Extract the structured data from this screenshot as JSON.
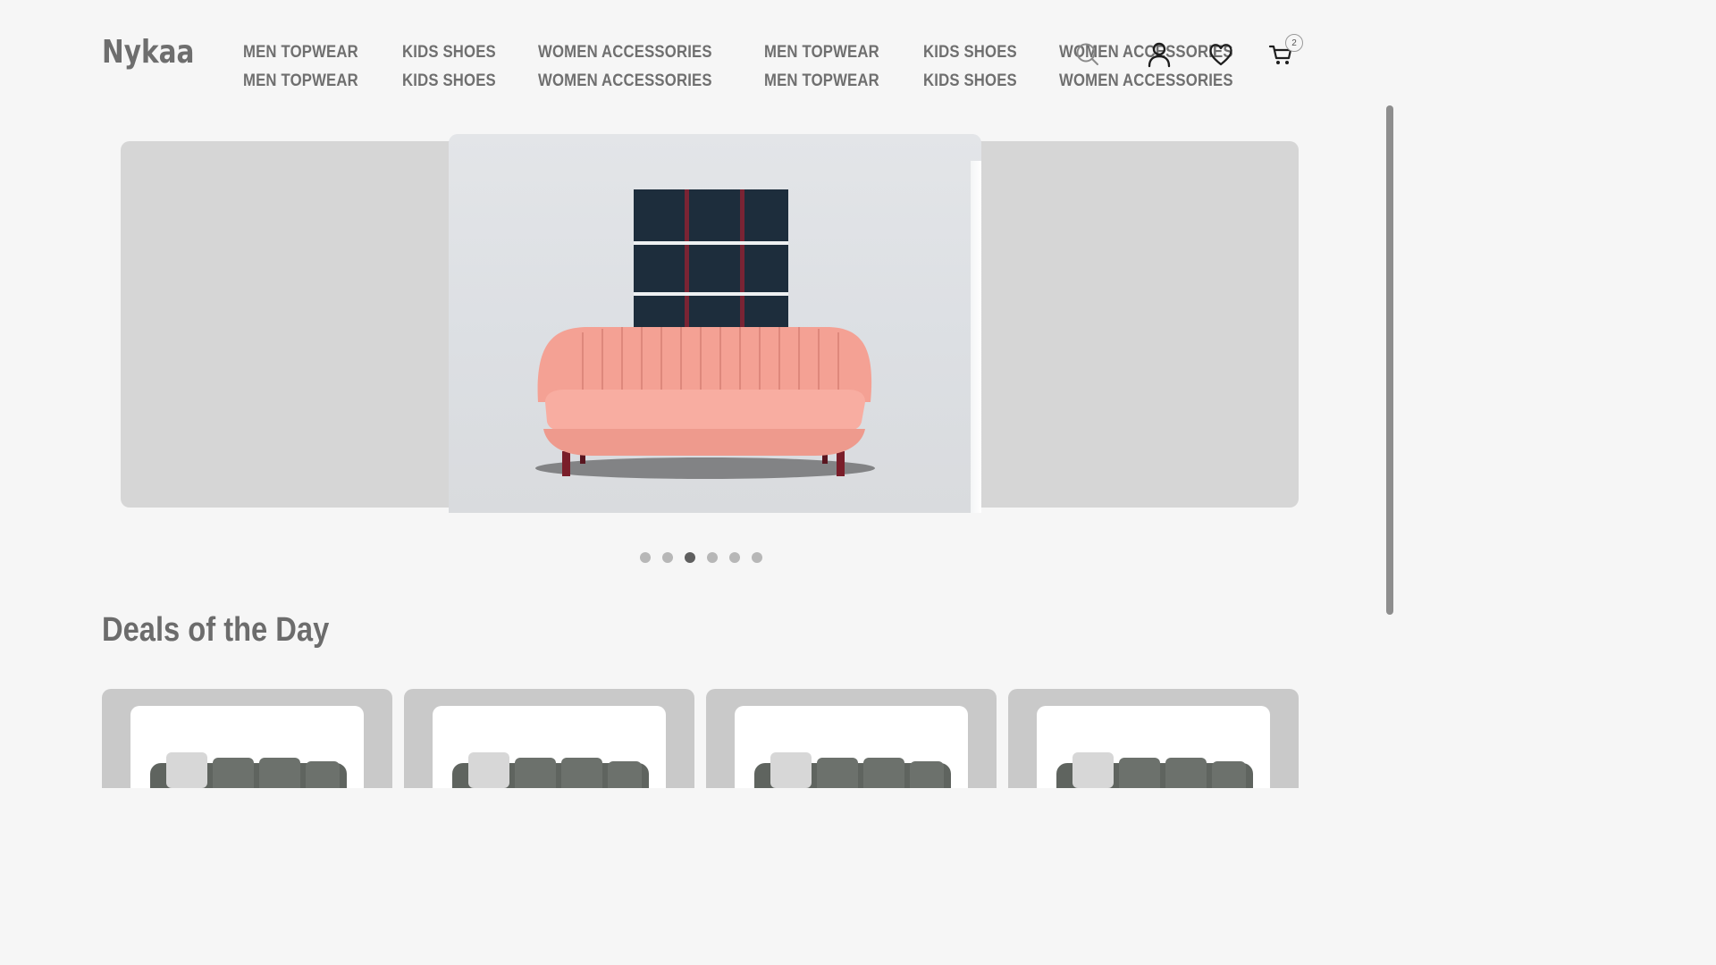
{
  "header": {
    "logo": "Nykaa",
    "nav": [
      "MEN TOPWEAR",
      "KIDS SHOES",
      "WOMEN ACCESSORIES",
      "MEN TOPWEAR",
      "KIDS SHOES",
      "WOMEN ACCESSORIES",
      "MEN TOPWEAR",
      "KIDS SHOES",
      "WOMEN ACCESSORIES",
      "MEN TOPWEAR",
      "KIDS SHOES",
      "WOMEN ACCESSORIES"
    ],
    "icons": [
      "search-icon",
      "user-icon",
      "heart-icon",
      "cart-icon"
    ],
    "cart_count": "2"
  },
  "hero": {
    "slides_count": 6,
    "active_slide": 3
  },
  "deals": {
    "title": "Deals of the Day",
    "cards": 4
  },
  "colors": {
    "background": "#f6f6f6",
    "text": "#6f6f6f",
    "sofa": "#f4a49a",
    "card": "#c9c9c9"
  }
}
